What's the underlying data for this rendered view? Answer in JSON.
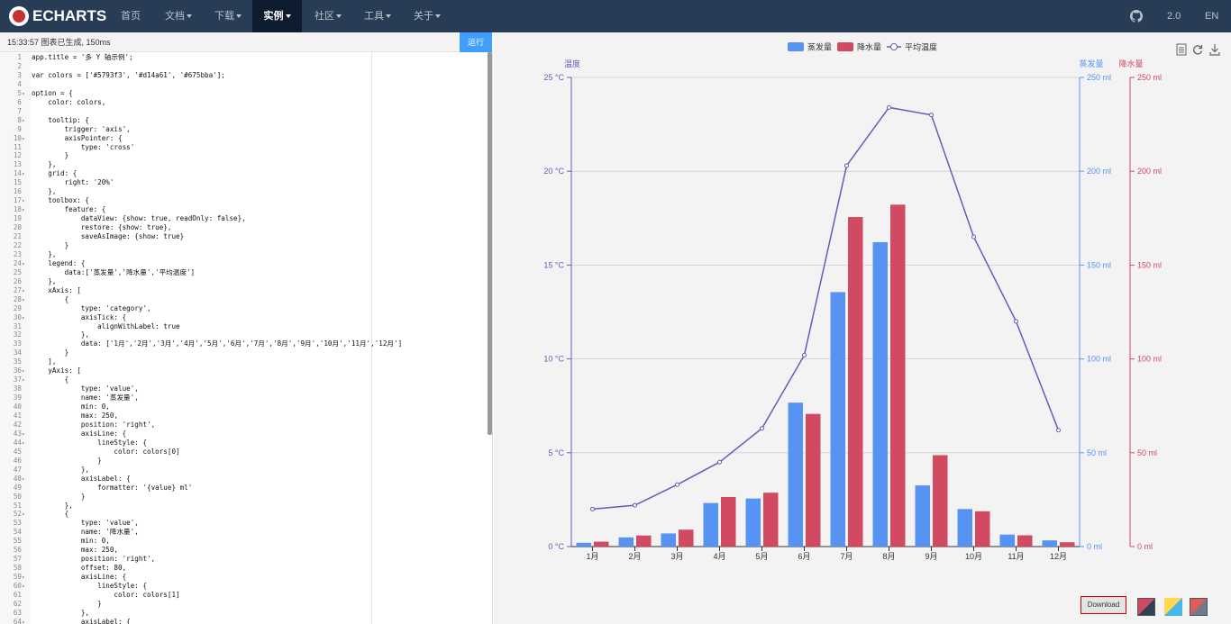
{
  "nav": {
    "logo": "ECHARTS",
    "items": [
      {
        "label": "首页",
        "dropdown": false,
        "active": false
      },
      {
        "label": "文档",
        "dropdown": true,
        "active": false
      },
      {
        "label": "下载",
        "dropdown": true,
        "active": false
      },
      {
        "label": "实例",
        "dropdown": true,
        "active": true
      },
      {
        "label": "社区",
        "dropdown": true,
        "active": false
      },
      {
        "label": "工具",
        "dropdown": true,
        "active": false
      },
      {
        "label": "关于",
        "dropdown": true,
        "active": false
      }
    ],
    "github_icon": "github-icon",
    "version": "2.0",
    "lang": "EN"
  },
  "editor": {
    "status": "15:33:57   图表已生成, 150ms",
    "run_label": "运行",
    "lines": [
      {
        "n": "1",
        "fold": "",
        "text": "app.title = '多 Y 轴示例';"
      },
      {
        "n": "2",
        "fold": "",
        "text": ""
      },
      {
        "n": "3",
        "fold": "",
        "text": "var colors = ['#5793f3', '#d14a61', '#675bba'];"
      },
      {
        "n": "4",
        "fold": "",
        "text": ""
      },
      {
        "n": "5",
        "fold": "▾",
        "text": "option = {"
      },
      {
        "n": "6",
        "fold": "",
        "text": "    color: colors,"
      },
      {
        "n": "7",
        "fold": "",
        "text": ""
      },
      {
        "n": "8",
        "fold": "▾",
        "text": "    tooltip: {"
      },
      {
        "n": "9",
        "fold": "",
        "text": "        trigger: 'axis',"
      },
      {
        "n": "10",
        "fold": "▾",
        "text": "        axisPointer: {"
      },
      {
        "n": "11",
        "fold": "",
        "text": "            type: 'cross'"
      },
      {
        "n": "12",
        "fold": "",
        "text": "        }"
      },
      {
        "n": "13",
        "fold": "",
        "text": "    },"
      },
      {
        "n": "14",
        "fold": "▾",
        "text": "    grid: {"
      },
      {
        "n": "15",
        "fold": "",
        "text": "        right: '20%'"
      },
      {
        "n": "16",
        "fold": "",
        "text": "    },"
      },
      {
        "n": "17",
        "fold": "▾",
        "text": "    toolbox: {"
      },
      {
        "n": "18",
        "fold": "▾",
        "text": "        feature: {"
      },
      {
        "n": "19",
        "fold": "",
        "text": "            dataView: {show: true, readOnly: false},"
      },
      {
        "n": "20",
        "fold": "",
        "text": "            restore: {show: true},"
      },
      {
        "n": "21",
        "fold": "",
        "text": "            saveAsImage: {show: true}"
      },
      {
        "n": "22",
        "fold": "",
        "text": "        }"
      },
      {
        "n": "23",
        "fold": "",
        "text": "    },"
      },
      {
        "n": "24",
        "fold": "▾",
        "text": "    legend: {"
      },
      {
        "n": "25",
        "fold": "",
        "text": "        data:['蒸发量','降水量','平均温度']"
      },
      {
        "n": "26",
        "fold": "",
        "text": "    },"
      },
      {
        "n": "27",
        "fold": "▾",
        "text": "    xAxis: ["
      },
      {
        "n": "28",
        "fold": "▾",
        "text": "        {"
      },
      {
        "n": "29",
        "fold": "",
        "text": "            type: 'category',"
      },
      {
        "n": "30",
        "fold": "▾",
        "text": "            axisTick: {"
      },
      {
        "n": "31",
        "fold": "",
        "text": "                alignWithLabel: true"
      },
      {
        "n": "32",
        "fold": "",
        "text": "            },"
      },
      {
        "n": "33",
        "fold": "",
        "text": "            data: ['1月','2月','3月','4月','5月','6月','7月','8月','9月','10月','11月','12月']"
      },
      {
        "n": "34",
        "fold": "",
        "text": "        }"
      },
      {
        "n": "35",
        "fold": "",
        "text": "    ],"
      },
      {
        "n": "36",
        "fold": "▾",
        "text": "    yAxis: ["
      },
      {
        "n": "37",
        "fold": "▾",
        "text": "        {"
      },
      {
        "n": "38",
        "fold": "",
        "text": "            type: 'value',"
      },
      {
        "n": "39",
        "fold": "",
        "text": "            name: '蒸发量',"
      },
      {
        "n": "40",
        "fold": "",
        "text": "            min: 0,"
      },
      {
        "n": "41",
        "fold": "",
        "text": "            max: 250,"
      },
      {
        "n": "42",
        "fold": "",
        "text": "            position: 'right',"
      },
      {
        "n": "43",
        "fold": "▾",
        "text": "            axisLine: {"
      },
      {
        "n": "44",
        "fold": "▾",
        "text": "                lineStyle: {"
      },
      {
        "n": "45",
        "fold": "",
        "text": "                    color: colors[0]"
      },
      {
        "n": "46",
        "fold": "",
        "text": "                }"
      },
      {
        "n": "47",
        "fold": "",
        "text": "            },"
      },
      {
        "n": "48",
        "fold": "▾",
        "text": "            axisLabel: {"
      },
      {
        "n": "49",
        "fold": "",
        "text": "                formatter: '{value} ml'"
      },
      {
        "n": "50",
        "fold": "",
        "text": "            }"
      },
      {
        "n": "51",
        "fold": "",
        "text": "        },"
      },
      {
        "n": "52",
        "fold": "▾",
        "text": "        {"
      },
      {
        "n": "53",
        "fold": "",
        "text": "            type: 'value',"
      },
      {
        "n": "54",
        "fold": "",
        "text": "            name: '降水量',"
      },
      {
        "n": "55",
        "fold": "",
        "text": "            min: 0,"
      },
      {
        "n": "56",
        "fold": "",
        "text": "            max: 250,"
      },
      {
        "n": "57",
        "fold": "",
        "text": "            position: 'right',"
      },
      {
        "n": "58",
        "fold": "",
        "text": "            offset: 80,"
      },
      {
        "n": "59",
        "fold": "▾",
        "text": "            axisLine: {"
      },
      {
        "n": "60",
        "fold": "▾",
        "text": "                lineStyle: {"
      },
      {
        "n": "61",
        "fold": "",
        "text": "                    color: colors[1]"
      },
      {
        "n": "62",
        "fold": "",
        "text": "                }"
      },
      {
        "n": "63",
        "fold": "",
        "text": "            },"
      },
      {
        "n": "64",
        "fold": "▾",
        "text": "            axisLabel: {"
      }
    ]
  },
  "toolbox": {
    "icons": [
      "data-view-icon",
      "restore-icon",
      "save-image-icon"
    ]
  },
  "download_label": "Download",
  "colors": {
    "evaporation": "#5793f3",
    "precipitation": "#d14a61",
    "temperature": "#675bba"
  },
  "chart_data": {
    "type": "bar",
    "categories": [
      "1月",
      "2月",
      "3月",
      "4月",
      "5月",
      "6月",
      "7月",
      "8月",
      "9月",
      "10月",
      "11月",
      "12月"
    ],
    "legend": [
      "蒸发量",
      "降水量",
      "平均温度"
    ],
    "legend_position": "top-center",
    "series": [
      {
        "name": "蒸发量",
        "type": "bar",
        "axis": "蒸发量",
        "values": [
          2.0,
          4.9,
          7.0,
          23.2,
          25.6,
          76.7,
          135.6,
          162.2,
          32.6,
          20.0,
          6.4,
          3.3
        ]
      },
      {
        "name": "降水量",
        "type": "bar",
        "axis": "降水量",
        "values": [
          2.6,
          5.9,
          9.0,
          26.4,
          28.7,
          70.7,
          175.6,
          182.2,
          48.7,
          18.8,
          6.0,
          2.3
        ]
      },
      {
        "name": "平均温度",
        "type": "line",
        "axis": "温度",
        "values": [
          2.0,
          2.2,
          3.3,
          4.5,
          6.3,
          10.2,
          20.3,
          23.4,
          23.0,
          16.5,
          12.0,
          6.2
        ]
      }
    ],
    "y_axes": [
      {
        "name": "温度",
        "position": "left",
        "ylim": [
          0,
          25
        ],
        "ticks": [
          "0 °C",
          "5 °C",
          "10 °C",
          "15 °C",
          "20 °C",
          "25 °C"
        ],
        "color": "#675bba"
      },
      {
        "name": "蒸发量",
        "position": "right",
        "ylim": [
          0,
          250
        ],
        "ticks": [
          "0 ml",
          "50 ml",
          "100 ml",
          "150 ml",
          "200 ml",
          "250 ml"
        ],
        "color": "#5793f3"
      },
      {
        "name": "降水量",
        "position": "right-offset",
        "ylim": [
          0,
          250
        ],
        "ticks": [
          "0 ml",
          "50 ml",
          "100 ml",
          "150 ml",
          "200 ml",
          "250 ml"
        ],
        "color": "#d14a61"
      }
    ],
    "grid": true
  }
}
